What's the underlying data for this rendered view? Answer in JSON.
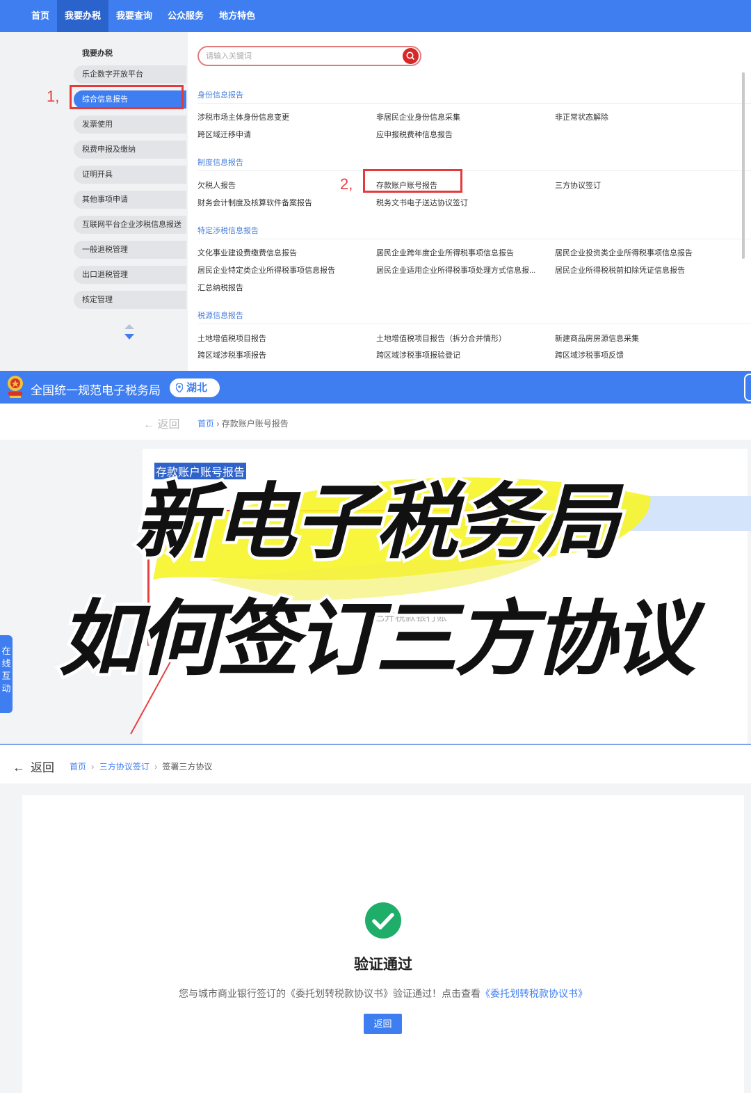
{
  "top_nav": {
    "items": [
      "首页",
      "我要办税",
      "我要查询",
      "公众服务",
      "地方特色"
    ],
    "active_index": 1
  },
  "sidebar": {
    "title": "我要办税",
    "items": [
      "乐企数字开放平台",
      "综合信息报告",
      "发票使用",
      "税费申报及缴纳",
      "证明开具",
      "其他事项申请",
      "互联网平台企业涉税信息报送",
      "一般退税管理",
      "出口退税管理",
      "核定管理"
    ],
    "active_index": 1
  },
  "annotations": {
    "step1": "1,",
    "step2": "2,"
  },
  "search": {
    "placeholder": "请输入关键词"
  },
  "sections": {
    "identity": {
      "title": "身份信息报告",
      "links": [
        "涉税市场主体身份信息变更",
        "非居民企业身份信息采集",
        "非正常状态解除",
        "跨区域迁移申请",
        "应申报税费种信息报告"
      ]
    },
    "system": {
      "title": "制度信息报告",
      "links": [
        "欠税人报告",
        "存款账户账号报告",
        "三方协议签订",
        "财务会计制度及核算软件备案报告",
        "税务文书电子送达协议签订"
      ]
    },
    "special": {
      "title": "特定涉税信息报告",
      "links": [
        "文化事业建设费缴费信息报告",
        "居民企业跨年度企业所得税事项信息报告",
        "居民企业投资类企业所得税事项信息报告",
        "居民企业特定类企业所得税事项信息报告",
        "居民企业适用企业所得税事项处理方式信息报...",
        "居民企业所得税税前扣除凭证信息报告",
        "汇总纳税报告"
      ]
    },
    "source": {
      "title": "税源信息报告",
      "links": [
        "土地增值税项目报告",
        "土地增值税项目报告（拆分合并情形）",
        "新建商品房房源信息采集",
        "跨区域涉税事项报告",
        "跨区域涉税事项报验登记",
        "跨区域涉税事项反馈"
      ]
    }
  },
  "panel2": {
    "site_title": "全国统一规范电子税务局",
    "region": "湖北",
    "back": "返回",
    "breadcrumb": [
      "首页",
      "存款账户账号报告"
    ],
    "selected_text": "存款账户账号报告",
    "ghost_text": "已开税款银行账",
    "left_float": "在线互动",
    "headline_line1": "新电子税务局",
    "headline_line2": "如何签订三方协议"
  },
  "panel3": {
    "back": "返回",
    "breadcrumb": [
      "首页",
      "三方协议签订",
      "签署三方协议"
    ],
    "result_title": "验证通过",
    "message_prefix": "您与城市商业银行签订的《委托划转税款协议书》验证通过！点击查看",
    "message_link": "《委托划转税款协议书》",
    "button": "返回"
  },
  "colors": {
    "primary_blue": "#3e7ef0",
    "annotation_red": "#e43a3a",
    "success_green": "#1fae6a",
    "highlight_yellow": "#f7f428"
  }
}
